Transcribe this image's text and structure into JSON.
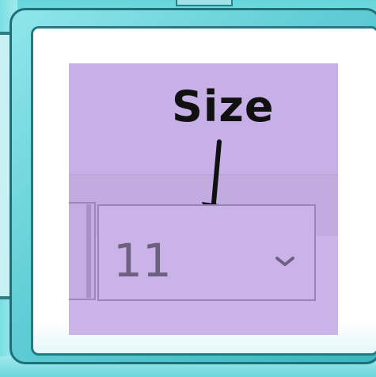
{
  "annotation": {
    "label": "Size"
  },
  "font_size_box": {
    "value": "11",
    "control": "dropdown"
  },
  "colors": {
    "highlight": "#c7b0e8",
    "frame": "#5fcdd4",
    "frame_border": "#1f6f77",
    "arrow": "#111111"
  },
  "icons": {
    "dropdown": "chevron-down-icon",
    "pointer": "arrow-down-icon"
  }
}
